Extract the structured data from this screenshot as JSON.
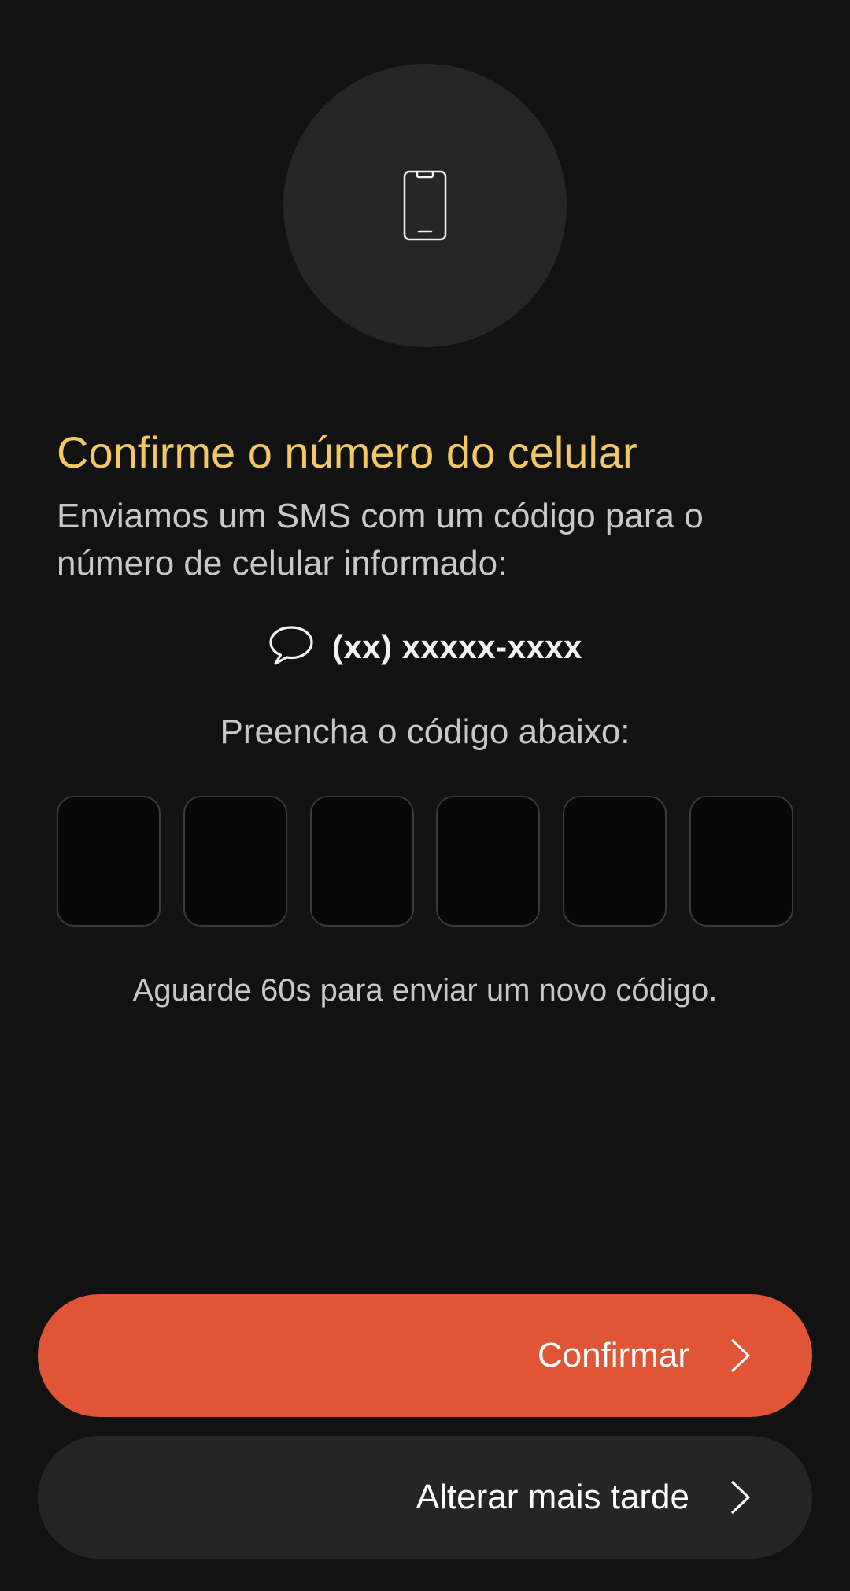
{
  "header": {
    "icon": "smartphone-icon"
  },
  "title": "Confirme o número do celular",
  "subtitle": "Enviamos um SMS com um código para o número de celular informado:",
  "phone": {
    "icon": "chat-bubble-icon",
    "number": "(xx) xxxxx-xxxx"
  },
  "instruction": "Preencha o código abaixo:",
  "code": {
    "digits": [
      "",
      "",
      "",
      "",
      "",
      ""
    ]
  },
  "resend_text": "Aguarde 60s para enviar um novo código.",
  "buttons": {
    "confirm_label": "Confirmar",
    "later_label": "Alterar mais tarde"
  },
  "colors": {
    "background": "#121212",
    "title": "#f2c866",
    "primary": "#df5535",
    "secondary": "#252525"
  }
}
